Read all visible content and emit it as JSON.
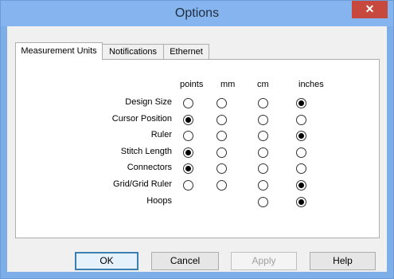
{
  "window": {
    "title": "Options",
    "close_glyph": "✕"
  },
  "tabs": [
    {
      "label": "Measurement Units",
      "active": true
    },
    {
      "label": "Notifications",
      "active": false
    },
    {
      "label": "Ethernet",
      "active": false
    }
  ],
  "columns": [
    "points",
    "mm",
    "cm",
    "inches"
  ],
  "rows": [
    {
      "label": "Design Size",
      "selected": "inches",
      "options": [
        "points",
        "mm",
        "cm",
        "inches"
      ]
    },
    {
      "label": "Cursor Position",
      "selected": "points",
      "options": [
        "points",
        "mm",
        "cm",
        "inches"
      ]
    },
    {
      "label": "Ruler",
      "selected": "inches",
      "options": [
        "points",
        "mm",
        "cm",
        "inches"
      ]
    },
    {
      "label": "Stitch Length",
      "selected": "points",
      "options": [
        "points",
        "mm",
        "cm",
        "inches"
      ]
    },
    {
      "label": "Connectors",
      "selected": "points",
      "options": [
        "points",
        "mm",
        "cm",
        "inches"
      ]
    },
    {
      "label": "Grid/Grid Ruler",
      "selected": "inches",
      "options": [
        "points",
        "mm",
        "cm",
        "inches"
      ]
    },
    {
      "label": "Hoops",
      "selected": "inches",
      "options": [
        "cm",
        "inches"
      ]
    }
  ],
  "buttons": {
    "ok": "OK",
    "cancel": "Cancel",
    "apply": "Apply",
    "help": "Help"
  },
  "colors": {
    "titlebar": "#86b4ee",
    "close": "#c7483c"
  }
}
